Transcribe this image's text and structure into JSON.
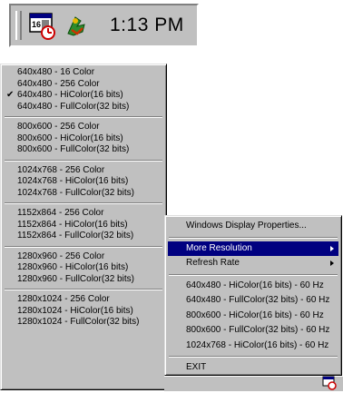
{
  "tray": {
    "icons": [
      "display-resolution-icon",
      "app-tray-icon"
    ],
    "clock": "1:13 PM"
  },
  "resolution_menu": {
    "groups": [
      [
        "640x480 - 16 Color",
        "640x480 - 256 Color",
        "640x480 - HiColor(16 bits)",
        "640x480 - FullColor(32 bits)"
      ],
      [
        "800x600 - 256 Color",
        "800x600 - HiColor(16 bits)",
        "800x600 - FullColor(32 bits)"
      ],
      [
        "1024x768 - 256 Color",
        "1024x768 - HiColor(16 bits)",
        "1024x768 - FullColor(32 bits)"
      ],
      [
        "1152x864 - 256 Color",
        "1152x864 - HiColor(16 bits)",
        "1152x864 - FullColor(32 bits)"
      ],
      [
        "1280x960 - 256 Color",
        "1280x960 - HiColor(16 bits)",
        "1280x960 - FullColor(32 bits)"
      ],
      [
        "1280x1024 - 256 Color",
        "1280x1024 - HiColor(16 bits)",
        "1280x1024 - FullColor(32 bits)"
      ]
    ],
    "checked_item": "640x480 - HiColor(16 bits)",
    "check_glyph": "✔"
  },
  "context_menu": {
    "display_properties": "Windows Display Properties...",
    "more_resolution": "More Resolution",
    "refresh_rate": "Refresh Rate",
    "refresh_options": [
      "640x480 - HiColor(16 bits) - 60 Hz",
      "640x480 - FullColor(32 bits) - 60 Hz",
      "800x600 - HiColor(16 bits) - 60 Hz",
      "800x600 - FullColor(32 bits) - 60 Hz",
      "1024x768 - HiColor(16 bits) - 60 Hz"
    ],
    "exit": "EXIT"
  },
  "colors": {
    "menu_face": "#c0c0c0",
    "highlight": "#000080",
    "highlight_text": "#ffffff"
  }
}
